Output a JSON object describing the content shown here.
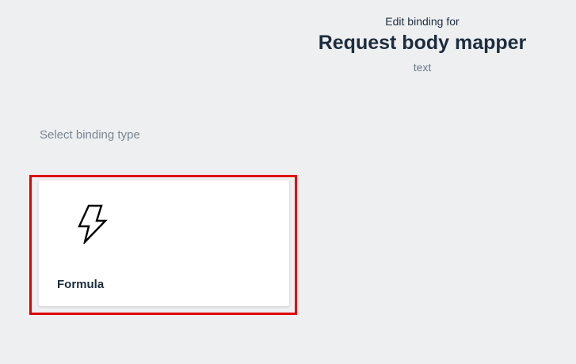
{
  "header": {
    "overline": "Edit binding for",
    "title": "Request body mapper",
    "subtitle": "text"
  },
  "binding_section": {
    "label": "Select binding type",
    "options": [
      {
        "label": "Formula",
        "icon": "lightning-bolt-icon",
        "selected": true
      }
    ]
  },
  "colors": {
    "background": "#eeeff1",
    "highlight_border": "#e00000",
    "card_background": "#ffffff",
    "text_primary": "#1d2d3e",
    "text_muted": "#7a8593"
  }
}
